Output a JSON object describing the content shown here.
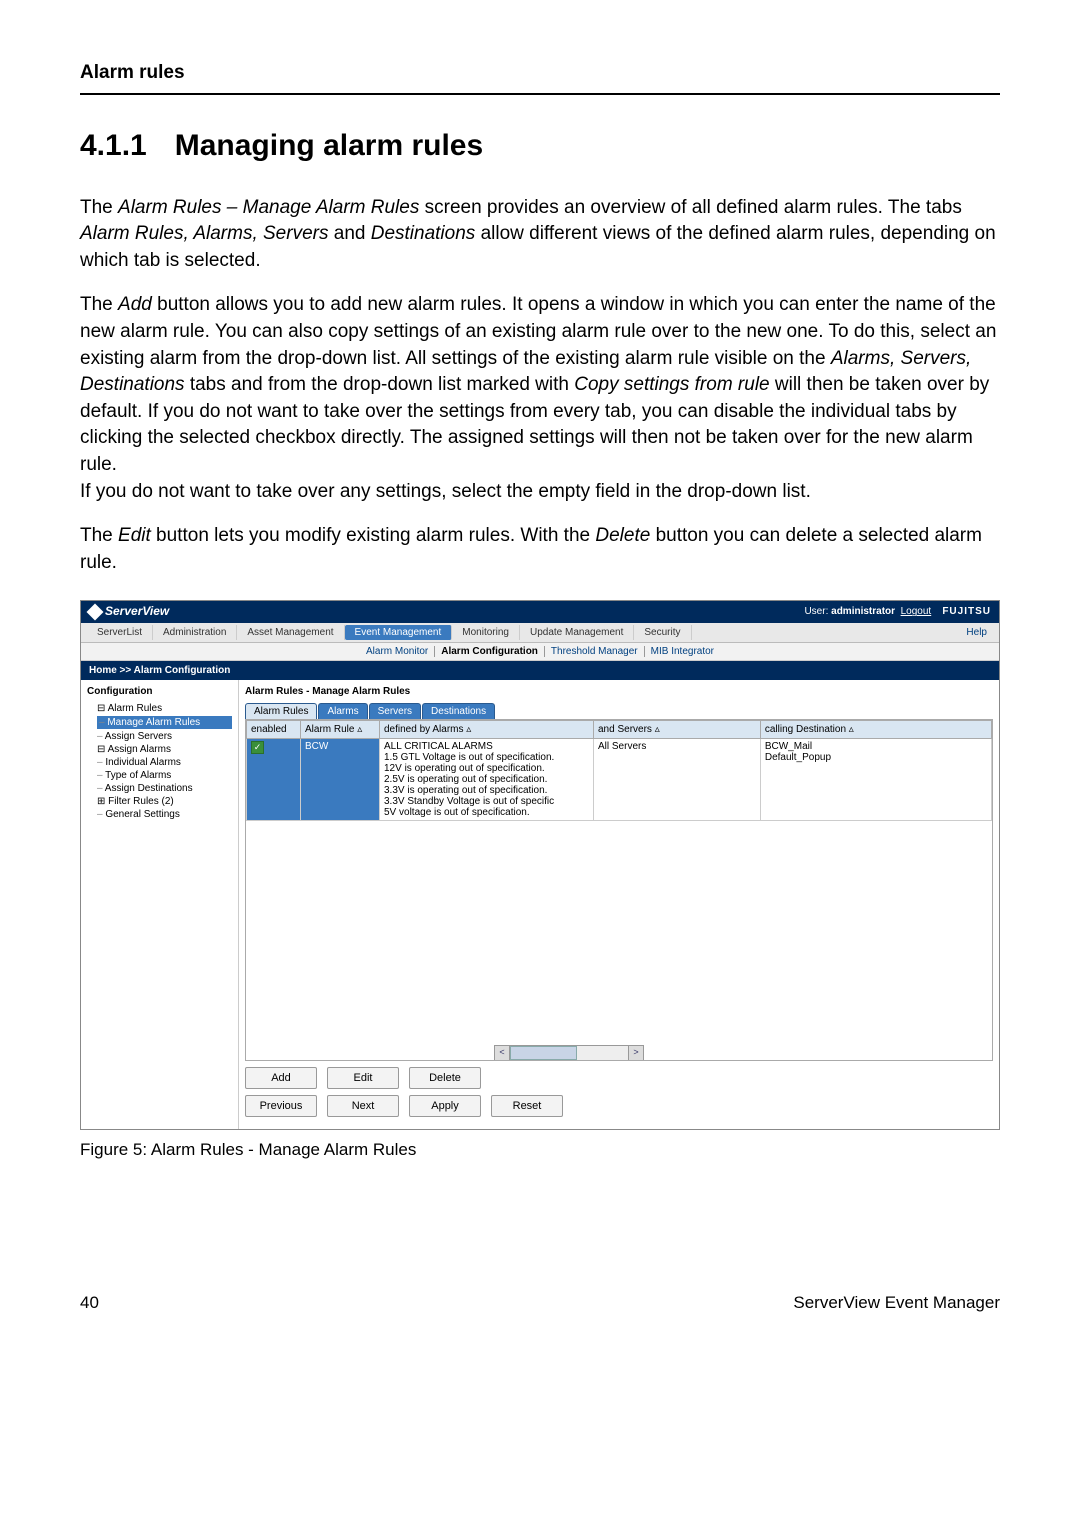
{
  "header": {
    "section": "Alarm rules"
  },
  "title": {
    "number": "4.1.1",
    "text": "Managing alarm rules"
  },
  "para1": {
    "p1a": "The ",
    "p1b": "Alarm Rules – Manage Alarm Rules",
    "p1c": " screen provides an overview of all defined alarm rules. The tabs ",
    "p1d": "Alarm Rules, Alarms, Servers",
    "p1e": " and ",
    "p1f": "Destinations",
    "p1g": " allow different views of the defined alarm rules, depending on which tab is selected."
  },
  "para2": {
    "p2a": "The ",
    "p2b": "Add",
    "p2c": " button allows you to add new alarm rules. It opens a window in which you can enter the name of the new alarm rule. You can also copy settings of an existing alarm rule over to the new one. To do this, select an existing alarm from the drop-down list. All settings of the existing alarm rule visible on the ",
    "p2d": "Alarms, Servers, Destinations",
    "p2e": " tabs and from the drop-down list marked with ",
    "p2f": "Copy settings from rule",
    "p2g": " will then be taken over by default. If you do not want to take over the settings from every tab, you can disable the individual tabs by clicking the selected checkbox directly. The assigned settings will then not be taken over for the new alarm rule.",
    "p2h": "If you do not want to take over any settings, select the empty field in the drop-down list."
  },
  "para3": {
    "p3a": "The ",
    "p3b": "Edit",
    "p3c": " button lets you modify existing alarm rules. With the ",
    "p3d": "Delete",
    "p3e": " button you can delete a selected alarm rule."
  },
  "figure": {
    "brand": "ServerView",
    "user_label": "User:",
    "user_name": "administrator",
    "logout": "Logout",
    "vendor": "FUJITSU",
    "menu": [
      "ServerList",
      "Administration",
      "Asset Management",
      "Event Management",
      "Monitoring",
      "Update Management",
      "Security"
    ],
    "menu_active": "Event Management",
    "help": "Help",
    "submenu": [
      "Alarm Monitor",
      "Alarm Configuration",
      "Threshold Manager",
      "MIB Integrator"
    ],
    "submenu_active": "Alarm Configuration",
    "breadcrumb": "Home >> Alarm Configuration",
    "tree": {
      "title": "Configuration",
      "items": [
        {
          "label": "Alarm Rules",
          "cls": "root"
        },
        {
          "label": "Manage Alarm Rules",
          "cls": "sel"
        },
        {
          "label": "Assign Servers",
          "cls": ""
        },
        {
          "label": "Assign Alarms",
          "cls": "node"
        },
        {
          "label": "Individual Alarms",
          "cls": ""
        },
        {
          "label": "Type of Alarms",
          "cls": ""
        },
        {
          "label": "Assign Destinations",
          "cls": ""
        },
        {
          "label": "Filter Rules (2)",
          "cls": "plus"
        },
        {
          "label": "General Settings",
          "cls": ""
        }
      ]
    },
    "main_title": "Alarm Rules - Manage Alarm Rules",
    "tabs": [
      "Alarm Rules",
      "Alarms",
      "Servers",
      "Destinations"
    ],
    "tab_active": "Alarm Rules",
    "columns": [
      "enabled",
      "Alarm Rule  ▵",
      "defined by Alarms  ▵",
      "and Servers  ▵",
      "calling Destination  ▵"
    ],
    "row": {
      "enabled": "✓",
      "rule": "BCW",
      "alarms": [
        "ALL CRITICAL ALARMS",
        "1.5 GTL Voltage is out of specification.",
        "12V is operating out of specification.",
        "2.5V is operating out of specification.",
        "3.3V is operating out of specification.",
        "3.3V Standby Voltage is out of specific",
        "5V voltage is out of specification."
      ],
      "servers": "All Servers",
      "destinations": [
        "BCW_Mail",
        "Default_Popup"
      ]
    },
    "buttons_row1": [
      "Add",
      "Edit",
      "Delete"
    ],
    "buttons_row2": [
      "Previous",
      "Next",
      "Apply",
      "Reset"
    ],
    "caption": "Figure 5: Alarm Rules - Manage Alarm Rules"
  },
  "footer": {
    "page": "40",
    "doc": "ServerView Event Manager"
  }
}
